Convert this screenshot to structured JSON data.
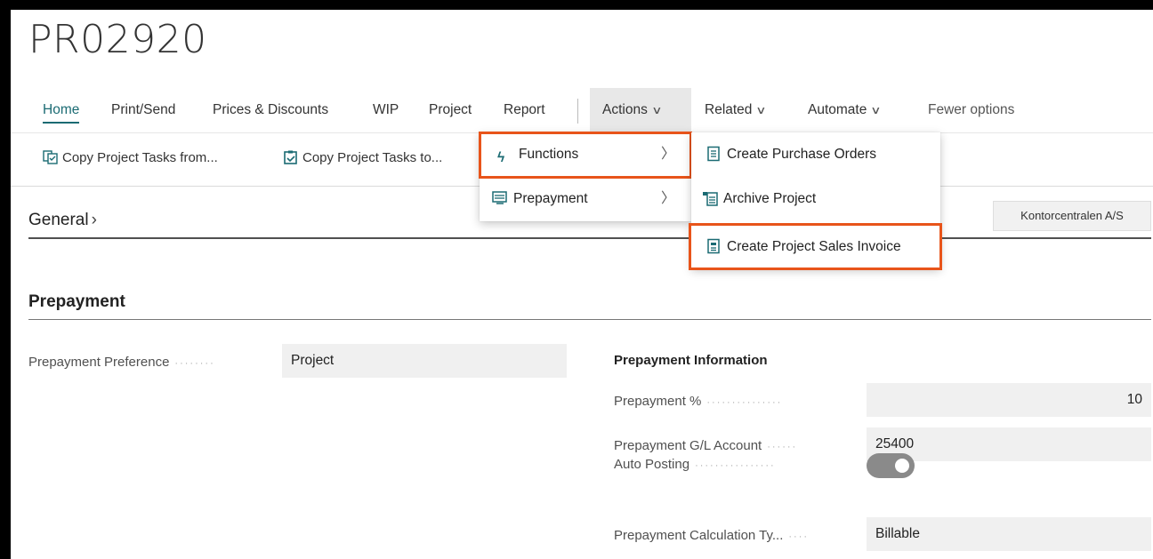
{
  "page": {
    "title": "PR02920"
  },
  "tabs": [
    {
      "label": "Home"
    },
    {
      "label": "Print/Send"
    },
    {
      "label": "Prices & Discounts"
    },
    {
      "label": "WIP"
    },
    {
      "label": "Project"
    },
    {
      "label": "Report"
    },
    {
      "label": "Actions"
    },
    {
      "label": "Related"
    },
    {
      "label": "Automate"
    },
    {
      "label": "Fewer options"
    }
  ],
  "subbar": {
    "copy_from": "Copy Project Tasks from...",
    "copy_to": "Copy Project Tasks to..."
  },
  "actions_menu": {
    "items": [
      {
        "label": "Functions",
        "icon": "lightning-icon"
      },
      {
        "label": "Prepayment",
        "icon": "prepayment-icon"
      }
    ]
  },
  "functions_submenu": {
    "items": [
      {
        "label": "Create Purchase Orders",
        "icon": "purchase-order-icon"
      },
      {
        "label": "Archive Project",
        "icon": "archive-icon"
      },
      {
        "label": "Create Project Sales Invoice",
        "icon": "sales-invoice-icon"
      }
    ]
  },
  "general": {
    "title": "General",
    "customer": "Kontorcentralen A/S"
  },
  "prepayment": {
    "title": "Prepayment",
    "preference_label": "Prepayment Preference",
    "preference_value": "Project",
    "info_heading": "Prepayment Information",
    "percent_label": "Prepayment %",
    "percent_value": "10",
    "gl_label": "Prepayment  G/L Account",
    "gl_value": "25400",
    "auto_posting_label": "Auto Posting",
    "auto_posting_on": true,
    "calc_type_label": "Prepayment Calculation Ty...",
    "calc_type_value": "Billable"
  },
  "colors": {
    "accent": "#1b6b73",
    "highlight": "#e8541a",
    "icon_teal": "#1b6b73"
  }
}
